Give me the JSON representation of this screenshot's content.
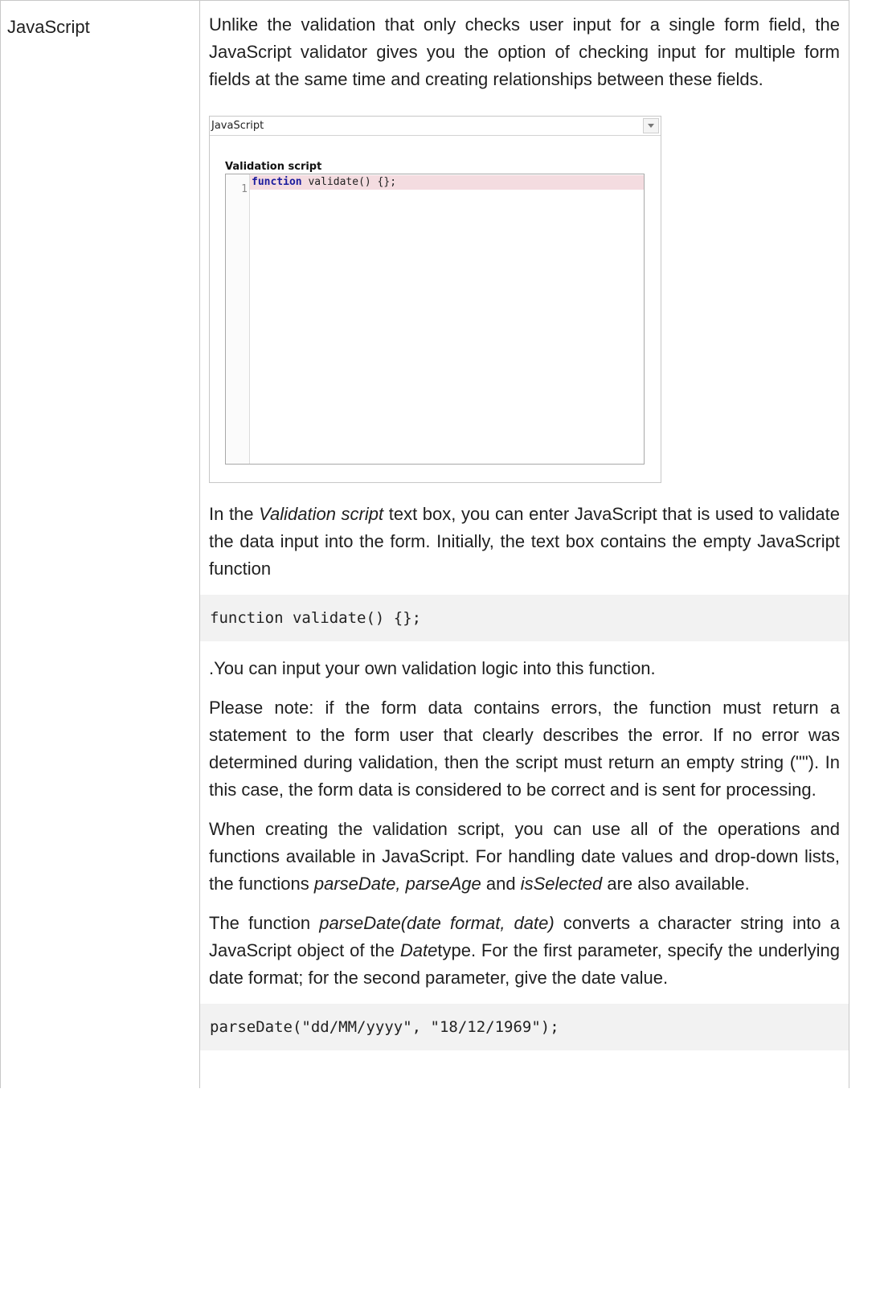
{
  "row": {
    "label": "JavaScript"
  },
  "intro": "Unlike the validation that only checks user input for a single form field, the JavaScript validator gives you the option of checking input for multiple form fields at the same time and creating relationships between these fields.",
  "screenshot": {
    "select_value": "JavaScript",
    "section_label": "Validation script",
    "line_number": "1",
    "code_keyword": "function",
    "code_rest": " validate() {};"
  },
  "para2": {
    "before": "In the ",
    "em": "Validation script",
    "after": " text box, you can enter JavaScript that is used to validate the data input into the form. Initially, the text box contains the empty JavaScript function"
  },
  "code1": "function validate() {};",
  "para3": ".You can input your own validation logic into this function.",
  "para4": "Please note: if the form data contains errors, the function must return a statement to the form user that clearly describes the error. If no error was determined during validation, then the script must return an empty string (\"\"). In this case, the form data is considered to be correct and is sent for processing.",
  "para5": {
    "text1": "When creating the validation script, you can use all of the operations and functions available in JavaScript. For handling date values and drop-down lists, the functions ",
    "em1": "parseDate, parseAge",
    "text2": " and ",
    "em2": "isSelected",
    "text3": " are also available."
  },
  "para6": {
    "text1": "The function ",
    "em1": "parseDate(date format, date)",
    "text2": " converts a character string into a JavaScript object of the ",
    "em2": "Date",
    "text3": "type. For the first parameter, specify the underlying date format; for the second parameter, give the date value."
  },
  "code2": "parseDate(\"dd/MM/yyyy\", \"18/12/1969\");"
}
